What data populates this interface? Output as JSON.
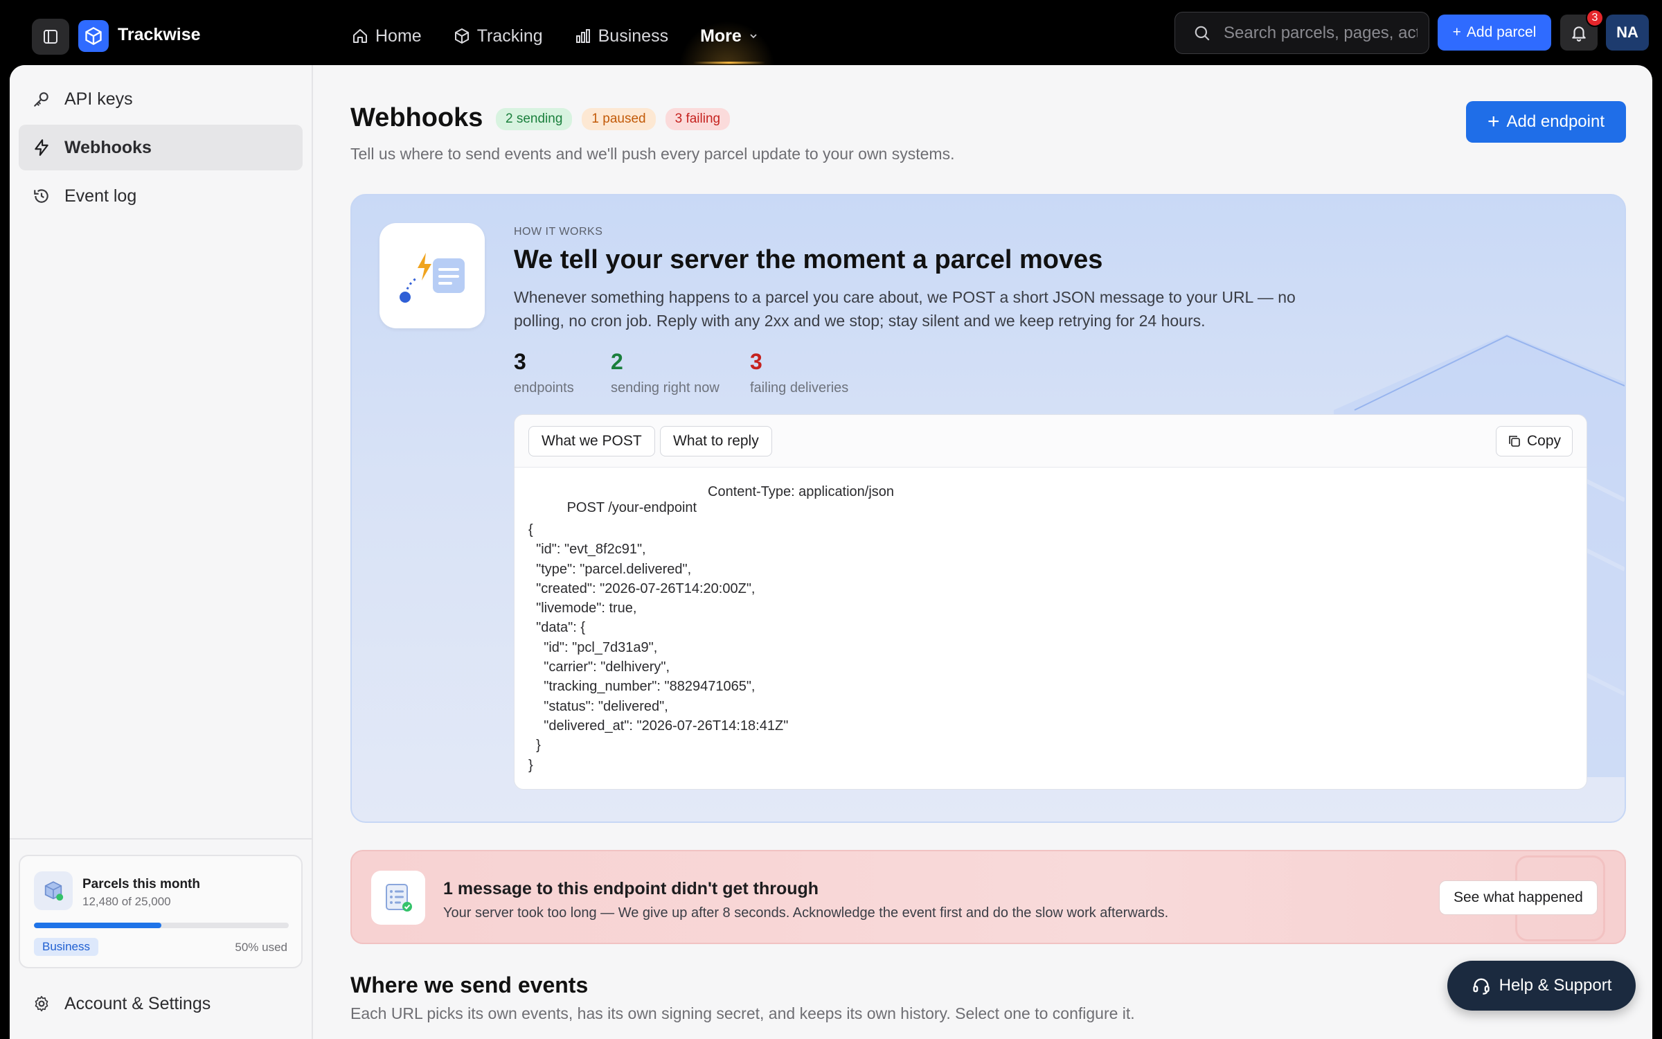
{
  "app": {
    "brand": "Trackwise"
  },
  "nav": [
    {
      "label": "Home",
      "icon": "home-icon"
    },
    {
      "label": "Tracking",
      "icon": "box-icon"
    },
    {
      "label": "Business",
      "icon": "bar-chart-icon"
    },
    {
      "label": "More",
      "icon": "chevron-down-icon"
    }
  ],
  "search": {
    "placeholder": "Search parcels, pages, actions"
  },
  "topbar": {
    "add_parcel_label": "Add parcel",
    "notification_count": "3",
    "avatar_initials": "NA"
  },
  "sidebar": {
    "items": [
      {
        "label": "API keys",
        "icon": "key-icon"
      },
      {
        "label": "Webhooks",
        "icon": "bolt-icon",
        "active": true
      },
      {
        "label": "Event log",
        "icon": "history-icon"
      }
    ],
    "usage": {
      "title": "Parcels this month",
      "count": "12,480 of 25,000",
      "fraction": 0.5,
      "plan": "Business",
      "used": "50% used"
    },
    "settings_label": "Account & Settings"
  },
  "page": {
    "title": "Webhooks",
    "badges": [
      "2 sending",
      "1 paused",
      "3 failing"
    ],
    "subtitle": "Tell us where to send events and we'll push every parcel update to your own systems.",
    "add_endpoint_label": "Add endpoint"
  },
  "how": {
    "eyebrow": "HOW IT WORKS",
    "title": "We tell your server the moment a parcel moves",
    "description": "Whenever something happens to a parcel you care about, we POST a short JSON message to your URL — no polling, no cron job. Reply with any 2xx and we stop; stay silent and we keep retrying for 24 hours.",
    "stats": [
      {
        "value": "3",
        "label": "endpoints",
        "color": "#111111"
      },
      {
        "value": "2",
        "label": "sending right now",
        "color": "#1a7f3c"
      },
      {
        "value": "3",
        "label": "failing deliveries",
        "color": "#c5221f"
      }
    ],
    "tabs": [
      "What we POST",
      "What to reply"
    ],
    "copy_label": "Copy",
    "request_line": "POST /your-endpoint",
    "content_type": "Content-Type: application/json",
    "code": "{\n  \"id\": \"evt_8f2c91\",\n  \"type\": \"parcel.delivered\",\n  \"created\": \"2026-07-26T14:20:00Z\",\n  \"livemode\": true,\n  \"data\": {\n    \"id\": \"pcl_7d31a9\",\n    \"carrier\": \"delhivery\",\n    \"tracking_number\": \"8829471065\",\n    \"status\": \"delivered\",\n    \"delivered_at\": \"2026-07-26T14:18:41Z\"\n  }\n}"
  },
  "alert": {
    "title": "1 message to this endpoint didn't get through",
    "description": "Your server took too long — We give up after 8 seconds. Acknowledge the event first and do the slow work afterwards.",
    "button_label": "See what happened"
  },
  "section": {
    "title": "Where we send events",
    "subtitle": "Each URL picks its own events, has its own signing secret, and keeps its own history. Select one to configure it."
  },
  "help_label": "Help & Support",
  "colors": {
    "accent": "#1f6ee8",
    "success": "#1a7f3c",
    "warning": "#c25a08",
    "danger": "#c5221f"
  }
}
